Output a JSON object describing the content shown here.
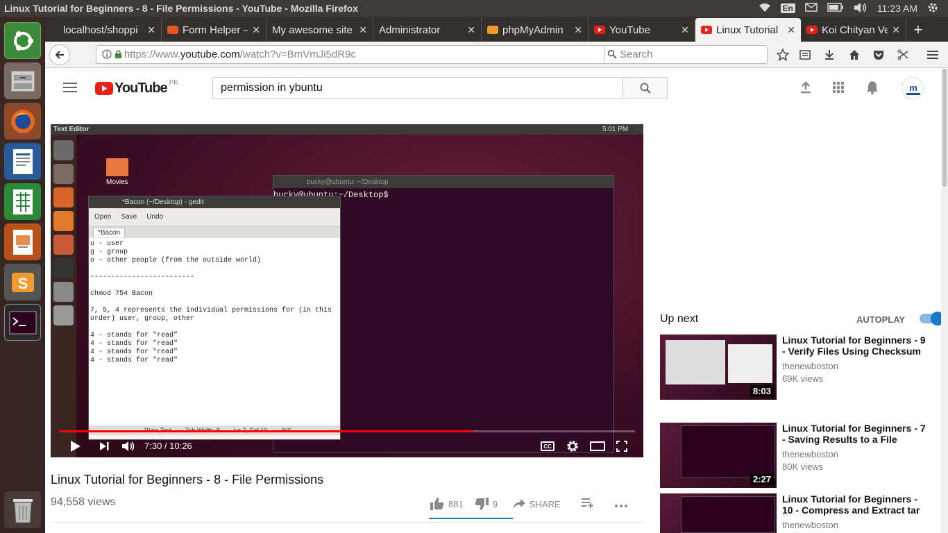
{
  "os": {
    "window_title": "Linux Tutorial for Beginners - 8 - File Permissions - YouTube - Mozilla Firefox",
    "keyboard_lang": "En",
    "clock": "11:23 AM",
    "launcher": [
      "ubuntu-logo-icon",
      "files-icon",
      "firefox-icon",
      "writer-icon",
      "calc-icon",
      "impress-icon",
      "sublime-icon",
      "terminal-icon",
      "trash-icon"
    ]
  },
  "browser": {
    "tabs": [
      {
        "label": "localhost/shoppi",
        "favicon": "none"
      },
      {
        "label": "Form Helper — ",
        "favicon": "codeigniter"
      },
      {
        "label": "My awesome site",
        "favicon": "none"
      },
      {
        "label": "Administrator",
        "favicon": "none"
      },
      {
        "label": "phpMyAdmin",
        "favicon": "pma"
      },
      {
        "label": "YouTube",
        "favicon": "youtube"
      },
      {
        "label": "Linux Tutorial",
        "favicon": "youtube",
        "active": true
      },
      {
        "label": "Koi Chityan Ve",
        "favicon": "youtube"
      }
    ],
    "new_tab": "+",
    "url_prefix": "https://www.",
    "url_domain": "youtube.com",
    "url_path": "/watch?v=BmVmJi5dR9c",
    "search_placeholder": "Search"
  },
  "youtube": {
    "logo_text": "YouTube",
    "region": "PK",
    "search_query": "permission in ybuntu",
    "video": {
      "title": "Linux Tutorial for Beginners - 8 - File Permissions",
      "views": "94,558 views",
      "likes": "881",
      "dislikes": "9",
      "share_label": "SHARE",
      "current_time": "7:30",
      "duration": "10:26",
      "time_display": "7:30 / 10:26",
      "progress_fraction": 0.719,
      "like_fraction": 0.99,
      "cc_label": "CC"
    },
    "video_content": {
      "top_title": "Text Editor",
      "top_time": "5:01 PM",
      "folder_label": "Movies",
      "terminal_title": "bucky@ubuntu: ~/Desktop",
      "terminal_prompt": "bucky@ubuntu:~/Desktop$ ",
      "gedit_title": "*Bacon (~/Desktop) - gedit",
      "gedit_open": "Open",
      "gedit_save": "Save",
      "gedit_undo": "Undo",
      "gedit_tab": "*Bacon",
      "gedit_text": "u - user\ng - group\no - other people (from the outside world)\n\n-------------------------\n\nchmod 754 Bacon\n\n7, 5, 4 represents the individual permissions for (in this\norder) user, group, other\n\n4 - stands for \"read\"\n4 - stands for \"read\"\n4 - stands for \"read\"\n4 - stands for \"read\"",
      "status_lang": "Plain Text",
      "status_tab": "Tab Width: 8",
      "status_pos": "Ln 7, Col 10",
      "status_ins": "INS"
    },
    "up_next_label": "Up next",
    "autoplay_label": "AUTOPLAY",
    "autoplay_on": true,
    "recommendations": [
      {
        "title": "Linux Tutorial for Beginners - 9 - Verify Files Using Checksum",
        "channel": "thenewboston",
        "views": "69K views",
        "duration": "8:03"
      },
      {
        "title": "Linux Tutorial for Beginners - 7 - Saving Results to a File",
        "channel": "thenewboston",
        "views": "80K views",
        "duration": "2:27"
      },
      {
        "title": "Linux Tutorial for Beginners - 10 - Compress and Extract tar",
        "channel": "thenewboston",
        "views": "",
        "duration": ""
      }
    ]
  }
}
